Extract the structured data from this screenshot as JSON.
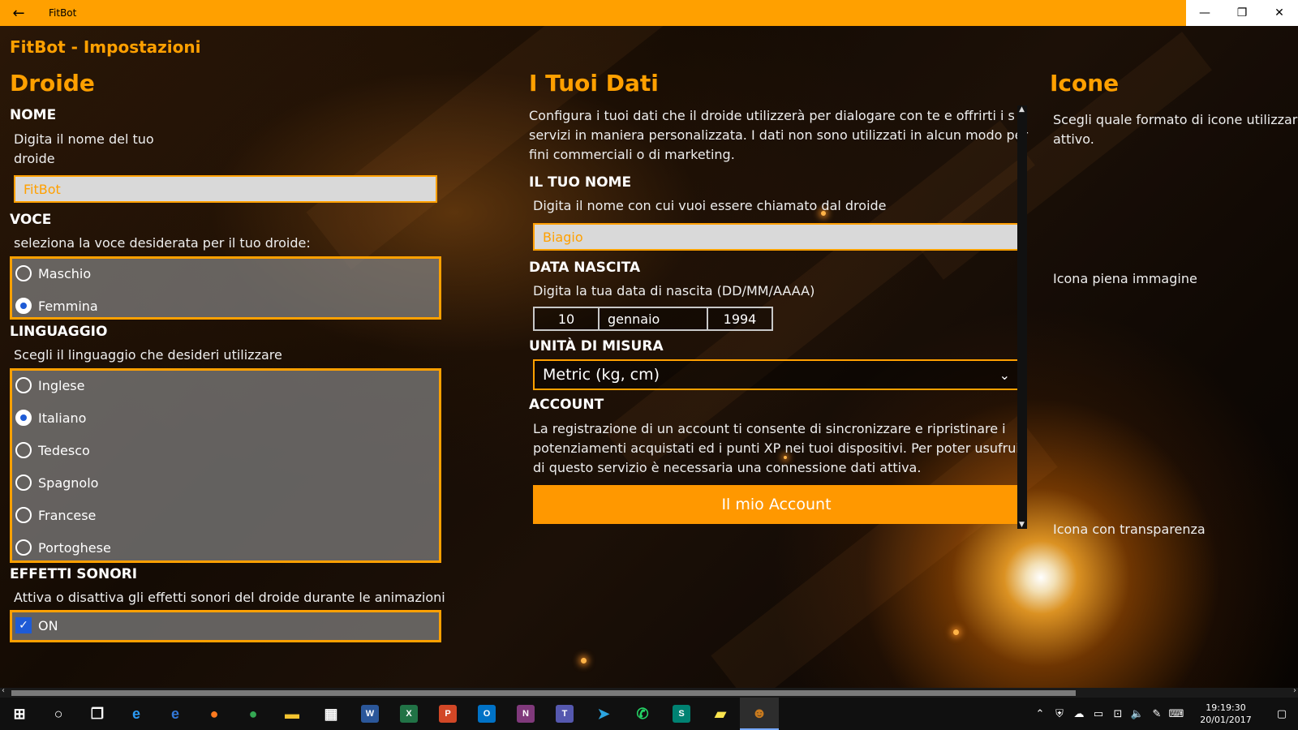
{
  "window": {
    "app_title": "FitBot",
    "back_icon": "arrow-left-icon",
    "controls": {
      "minimize": "—",
      "maximize": "❐",
      "close": "✕"
    }
  },
  "page_title": "FitBot - Impostazioni",
  "droide": {
    "heading": "Droide",
    "nome": {
      "label": "NOME",
      "desc": "Digita il nome del tuo droide",
      "value": "FitBot"
    },
    "voce": {
      "label": "VOCE",
      "desc": "seleziona la voce desiderata per il tuo droide:",
      "options": [
        "Maschio",
        "Femmina"
      ],
      "selected": "Femmina"
    },
    "linguaggio": {
      "label": "LINGUAGGIO",
      "desc": "Scegli il linguaggio che desideri utilizzare",
      "options": [
        "Inglese",
        "Italiano",
        "Tedesco",
        "Spagnolo",
        "Francese",
        "Portoghese"
      ],
      "selected": "Italiano"
    },
    "effetti": {
      "label": "EFFETTI SONORI",
      "desc": "Attiva o disattiva gli effetti sonori del droide durante le animazioni",
      "checkbox_label": "ON",
      "checked": true
    }
  },
  "dati": {
    "heading": "I Tuoi Dati",
    "intro_lines": [
      "Configura i tuoi dati che il droide utilizzerà per dialogare con te e offrirti i su",
      "servizi in maniera personalizzata. I dati non sono utilizzati in alcun modo per",
      "fini commerciali o di marketing."
    ],
    "nome": {
      "label": "IL TUO NOME",
      "desc": "Digita il nome con cui vuoi essere chiamato dal droide",
      "value": "Biagio"
    },
    "nascita": {
      "label": "DATA NASCITA",
      "desc": "Digita la tua data di nascita (DD/MM/AAAA)",
      "day": "10",
      "month": "gennaio",
      "year": "1994"
    },
    "unita": {
      "label": "UNITÀ DI MISURA",
      "selected": "Metric (kg, cm)"
    },
    "account": {
      "label": "ACCOUNT",
      "desc_lines": [
        "La registrazione di un account ti consente di sincronizzare e ripristinare i",
        "potenziamenti acquistati ed i punti XP nei tuoi dispositivi. Per poter usufruire",
        "di questo servizio è necessaria una connessione dati attiva."
      ],
      "button": "Il mio Account"
    }
  },
  "icone": {
    "heading": "Icone",
    "desc_lines": [
      "Scegli quale formato di icone utilizzare",
      "attivo."
    ],
    "option1": "Icona piena immagine",
    "option2": "Icona con transparenza"
  },
  "taskbar": {
    "apps": [
      {
        "name": "start-icon",
        "glyph": "⊞",
        "color": "#ffffff"
      },
      {
        "name": "cortana-icon",
        "glyph": "○",
        "color": "#ffffff"
      },
      {
        "name": "task-view-icon",
        "glyph": "❐",
        "color": "#ffffff"
      },
      {
        "name": "ie-icon",
        "glyph": "e",
        "color": "#2b9af3"
      },
      {
        "name": "edge-icon",
        "glyph": "e",
        "color": "#3277d8"
      },
      {
        "name": "firefox-icon",
        "glyph": "●",
        "color": "#ff7a1f"
      },
      {
        "name": "chrome-icon",
        "glyph": "●",
        "color": "#34a853"
      },
      {
        "name": "explorer-icon",
        "glyph": "▬",
        "color": "#f4c430"
      },
      {
        "name": "store-icon",
        "glyph": "▦",
        "color": "#ffffff"
      },
      {
        "name": "word-icon",
        "glyph": "W",
        "color": "#2b579a"
      },
      {
        "name": "excel-icon",
        "glyph": "X",
        "color": "#217346"
      },
      {
        "name": "powerpoint-icon",
        "glyph": "P",
        "color": "#d24726"
      },
      {
        "name": "outlook-icon",
        "glyph": "O",
        "color": "#0072c6"
      },
      {
        "name": "onenote-icon",
        "glyph": "N",
        "color": "#80397b"
      },
      {
        "name": "teams-icon",
        "glyph": "T",
        "color": "#5558af"
      },
      {
        "name": "telegram-icon",
        "glyph": "➤",
        "color": "#2ca5e0"
      },
      {
        "name": "whatsapp-icon",
        "glyph": "✆",
        "color": "#25d366"
      },
      {
        "name": "sway-icon",
        "glyph": "S",
        "color": "#008272"
      },
      {
        "name": "sticky-notes-icon",
        "glyph": "▰",
        "color": "#f9e44e"
      },
      {
        "name": "fitbot-app-icon",
        "glyph": "☻",
        "color": "#c87a1e"
      }
    ],
    "clock_time": "19:19:30",
    "clock_date": "20/01/2017"
  }
}
